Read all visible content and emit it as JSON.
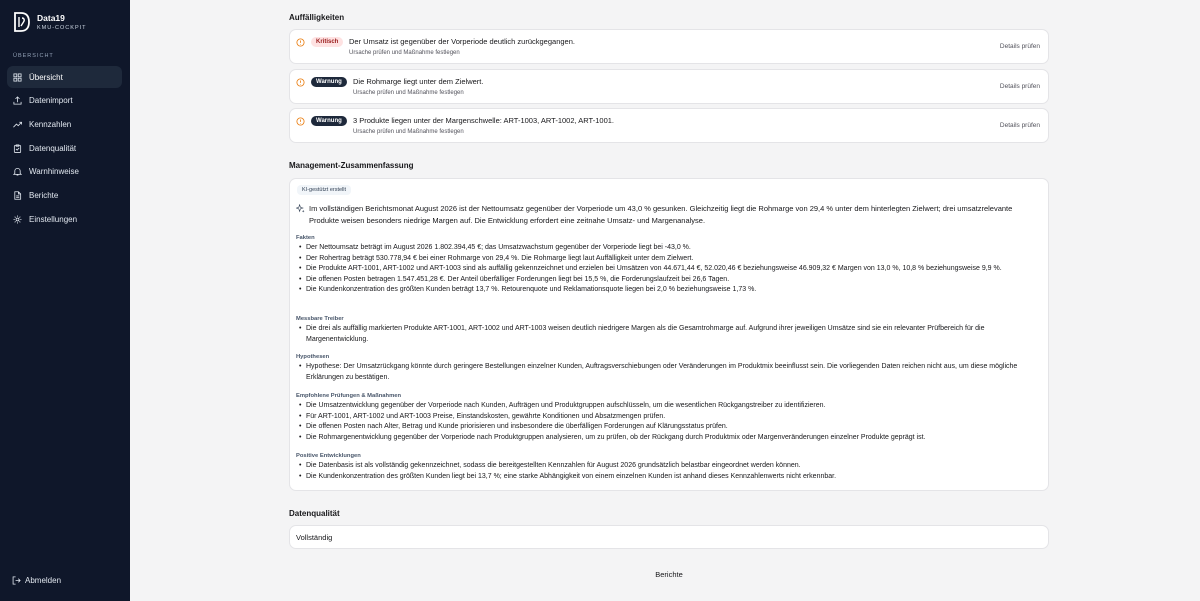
{
  "app": {
    "name": "Data19",
    "subtitle": "KMU-COCKPIT"
  },
  "sidebar": {
    "section_label": "ÜBERSICHT",
    "items": [
      {
        "label": "Übersicht",
        "icon": "grid-icon",
        "active": true
      },
      {
        "label": "Datenimport",
        "icon": "upload-icon",
        "active": false
      },
      {
        "label": "Kennzahlen",
        "icon": "trend-icon",
        "active": false
      },
      {
        "label": "Datenqualität",
        "icon": "clipboard-icon",
        "active": false
      },
      {
        "label": "Warnhinweise",
        "icon": "bell-icon",
        "active": false
      },
      {
        "label": "Berichte",
        "icon": "document-icon",
        "active": false
      },
      {
        "label": "Einstellungen",
        "icon": "gear-icon",
        "active": false
      }
    ],
    "logout_label": "Abmelden"
  },
  "alerts": {
    "heading": "Auffälligkeiten",
    "items": [
      {
        "badge": "Kritisch",
        "severity": "critical",
        "title": "Der Umsatz ist gegenüber der Vorperiode deutlich zurückgegangen.",
        "description": "Ursache prüfen und Maßnahme festlegen",
        "action": "Details prüfen"
      },
      {
        "badge": "Warnung",
        "severity": "warning",
        "title": "Die Rohmarge liegt unter dem Zielwert.",
        "description": "Ursache prüfen und Maßnahme festlegen",
        "action": "Details prüfen"
      },
      {
        "badge": "Warnung",
        "severity": "warning",
        "title": "3 Produkte liegen unter der Margenschwelle: ART-1003, ART-1002, ART-1001.",
        "description": "Ursache prüfen und Maßnahme festlegen",
        "action": "Details prüfen"
      }
    ]
  },
  "summary": {
    "heading": "Management-Zusammenfassung",
    "ai_badge": "KI-gestützt erstellt",
    "headline": "Im vollständigen Berichtsmonat August 2026 ist der Nettoumsatz gegenüber der Vorperiode um 43,0 % gesunken. Gleichzeitig liegt die Rohmarge von 29,4 % unter dem hinterlegten Zielwert; drei umsatzrelevante Produkte weisen besonders niedrige Margen auf. Die Entwicklung erfordert eine zeitnahe Umsatz- und Margenanalyse.",
    "sections": [
      {
        "label": "Fakten",
        "items": [
          "Der Nettoumsatz beträgt im August 2026 1.802.394,45 €; das Umsatzwachstum gegenüber der Vorperiode liegt bei -43,0 %.",
          "Der Rohertrag beträgt 530.778,94 € bei einer Rohmarge von 29,4 %. Die Rohmarge liegt laut Auffälligkeit unter dem Zielwert.",
          "Die Produkte ART-1001, ART-1002 und ART-1003 sind als auffällig gekennzeichnet und erzielen bei Umsätzen von 44.671,44 €, 52.020,46 € beziehungsweise 46.909,32 € Margen von 13,0 %, 10,8 % beziehungsweise 9,9 %.",
          "Die offenen Posten betragen 1.547.451,28 €. Der Anteil überfälliger Forderungen liegt bei 15,5 %, die Forderungslaufzeit bei 26,6 Tagen.",
          "Die Kundenkonzentration des größten Kunden beträgt 13,7 %. Retourenquote und Reklamationsquote liegen bei 2,0 % beziehungsweise 1,73 %."
        ]
      },
      {
        "label": "Messbare Treiber",
        "items": [
          "Die drei als auffällig markierten Produkte ART-1001, ART-1002 und ART-1003 weisen deutlich niedrigere Margen als die Gesamtrohmarge auf. Aufgrund ihrer jeweiligen Umsätze sind sie ein relevanter Prüfbereich für die Margenentwicklung."
        ]
      },
      {
        "label": "Hypothesen",
        "items": [
          "Hypothese: Der Umsatzrückgang könnte durch geringere Bestellungen einzelner Kunden, Auftragsverschiebungen oder Veränderungen im Produktmix beeinflusst sein. Die vorliegenden Daten reichen nicht aus, um diese mögliche Erklärungen zu bestätigen."
        ]
      },
      {
        "label": "Empfohlene Prüfungen & Maßnahmen",
        "items": [
          "Die Umsatzentwicklung gegenüber der Vorperiode nach Kunden, Aufträgen und Produktgruppen aufschlüsseln, um die wesentlichen Rückgangstreiber zu identifizieren.",
          "Für ART-1001, ART-1002 und ART-1003 Preise, Einstandskosten, gewährte Konditionen und Absatzmengen prüfen.",
          "Die offenen Posten nach Alter, Betrag und Kunde priorisieren und insbesondere die überfälligen Forderungen auf Klärungsstatus prüfen.",
          "Die Rohmargenentwicklung gegenüber der Vorperiode nach Produktgruppen analysieren, um zu prüfen, ob der Rückgang durch Produktmix oder Margenveränderungen einzelner Produkte geprägt ist."
        ]
      },
      {
        "label": "Positive Entwicklungen",
        "items": [
          "Die Datenbasis ist als vollständig gekennzeichnet, sodass die bereitgestellten Kennzahlen für August 2026 grundsätzlich belastbar eingeordnet werden können.",
          "Die Kundenkonzentration des größten Kunden liegt bei 13,7 %; eine starke Abhängigkeit von einem einzelnen Kunden ist anhand dieses Kennzahlenwerts nicht erkennbar."
        ]
      }
    ]
  },
  "data_quality": {
    "heading": "Datenqualität",
    "status": "Vollständig"
  },
  "footer": {
    "reports_link": "Berichte"
  }
}
